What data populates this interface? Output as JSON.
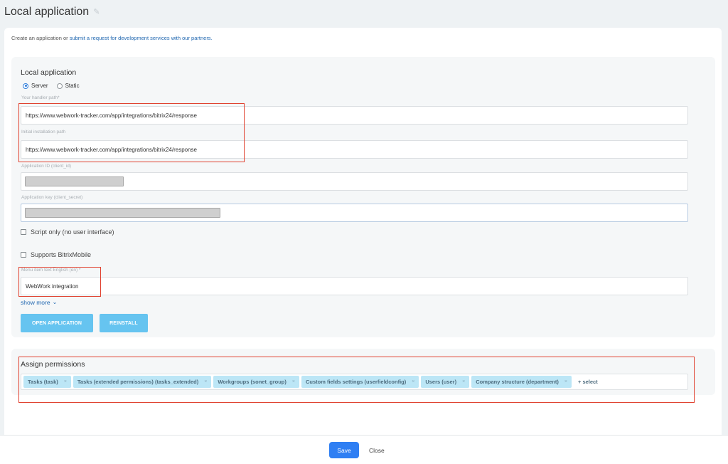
{
  "header": {
    "title": "Local application",
    "edit_icon": "pencil-icon"
  },
  "intro": {
    "text": "Create an application or ",
    "link_text": "submit a request for development services with our partners."
  },
  "app": {
    "section_title": "Local application",
    "type_options": [
      {
        "label": "Server",
        "checked": true
      },
      {
        "label": "Static",
        "checked": false
      }
    ],
    "handler_path": {
      "label": "Your handler path*",
      "value": "https://www.webwork-tracker.com/app/integrations/bitrix24/response"
    },
    "install_path": {
      "label": "Initial installation path",
      "value": "https://www.webwork-tracker.com/app/integrations/bitrix24/response"
    },
    "client_id": {
      "label": "Application ID (client_id)",
      "masked": true
    },
    "client_secret": {
      "label": "Application key (client_secret)",
      "masked": true
    },
    "script_only": {
      "label": "Script only (no user interface)",
      "checked": false
    },
    "bitrix_mobile": {
      "label": "Supports BitrixMobile",
      "checked": false
    },
    "menu_text": {
      "label": "Menu item text English (en) *",
      "value": "WebWork integration"
    },
    "show_more": "show more",
    "open_button": "OPEN APPLICATION",
    "reinstall_button": "REINSTALL"
  },
  "permissions": {
    "title": "Assign permissions",
    "tags": [
      "Tasks (task)",
      "Tasks (extended permissions) (tasks_extended)",
      "Workgroups (sonet_group)",
      "Custom fields settings (userfieldconfig)",
      "Users (user)",
      "Company structure (department)"
    ],
    "tag_close": "×",
    "select_label": "+ select"
  },
  "footer": {
    "save": "Save",
    "close": "Close"
  },
  "colors": {
    "accent": "#2f7ff3",
    "button_light_blue": "#66c4f0",
    "highlight_red": "#e0412f",
    "tag_bg": "#bce6f6"
  }
}
